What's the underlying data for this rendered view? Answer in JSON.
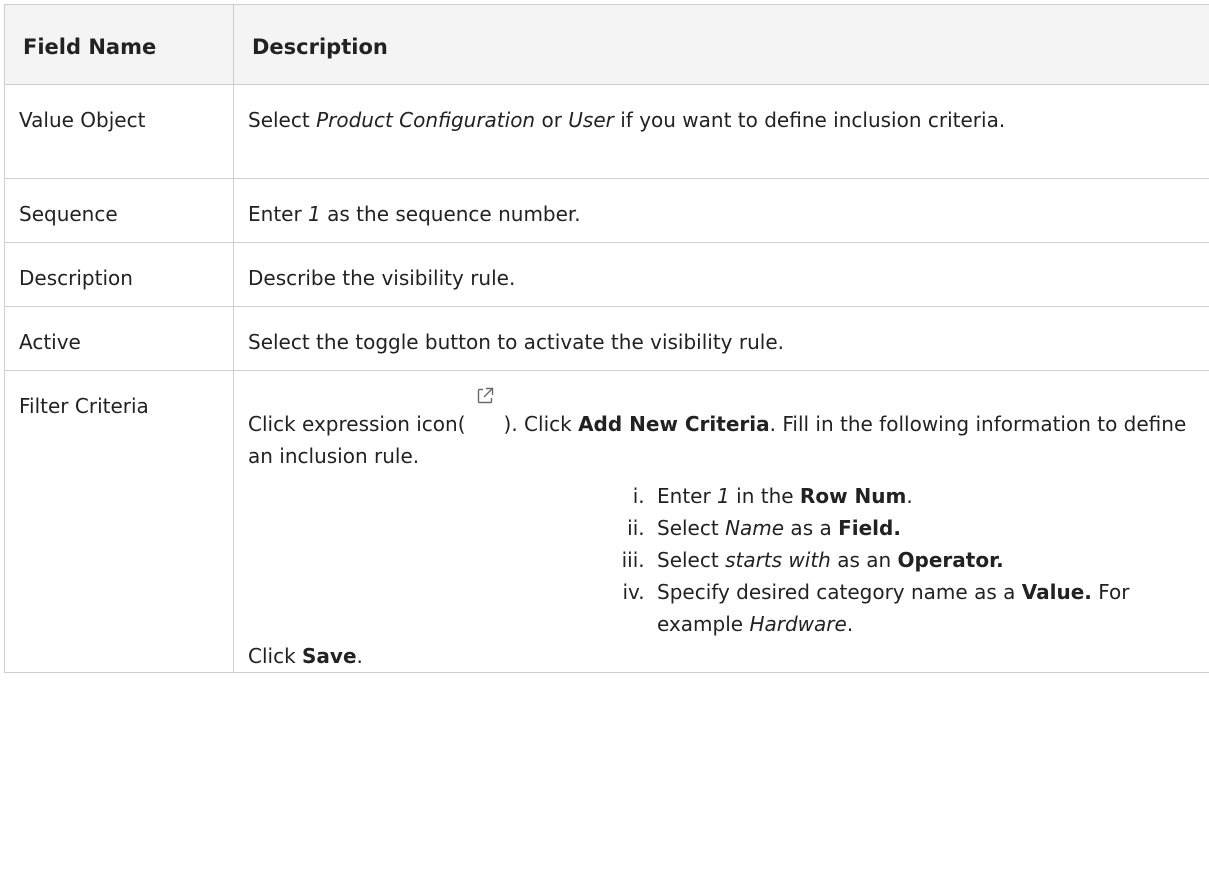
{
  "header": {
    "field_name": "Field Name",
    "description": "Description"
  },
  "rows": {
    "value_object": {
      "name": "Value Object",
      "pre": "Select ",
      "opt1": "Product Configuration",
      "mid": " or ",
      "opt2": "User",
      "post": " if you want to define inclusion criteria."
    },
    "sequence": {
      "name": "Sequence",
      "pre": "Enter ",
      "num": "1",
      "post": " as the sequence number."
    },
    "description": {
      "name": "Description",
      "text": "Describe the visibility rule."
    },
    "active": {
      "name": "Active",
      "text": "Select the toggle button to activate the visibility rule."
    },
    "filter": {
      "name": "Filter Criteria",
      "pre": "Click expression icon(",
      "icon": "external-link-icon",
      "mid": "). Click ",
      "add_new": "Add New Criteria",
      "post": ". Fill in the following information to define an inclusion rule.",
      "steps": [
        {
          "pre": "Enter ",
          "em": "1",
          "mid": " in the ",
          "b": "Row Num",
          "post": "."
        },
        {
          "pre": "Select ",
          "em": "Name",
          "mid": " as a ",
          "b": "Field.",
          "post": ""
        },
        {
          "pre": "Select ",
          "em": "starts with",
          "mid": " as an ",
          "b": "Operator.",
          "post": ""
        },
        {
          "pre": "Specify desired category name as a ",
          "b": "Value.",
          "post": " For example ",
          "em": "Hardware",
          "end": "."
        }
      ],
      "click_pre": "Click ",
      "save": "Save",
      "click_post": "."
    }
  }
}
